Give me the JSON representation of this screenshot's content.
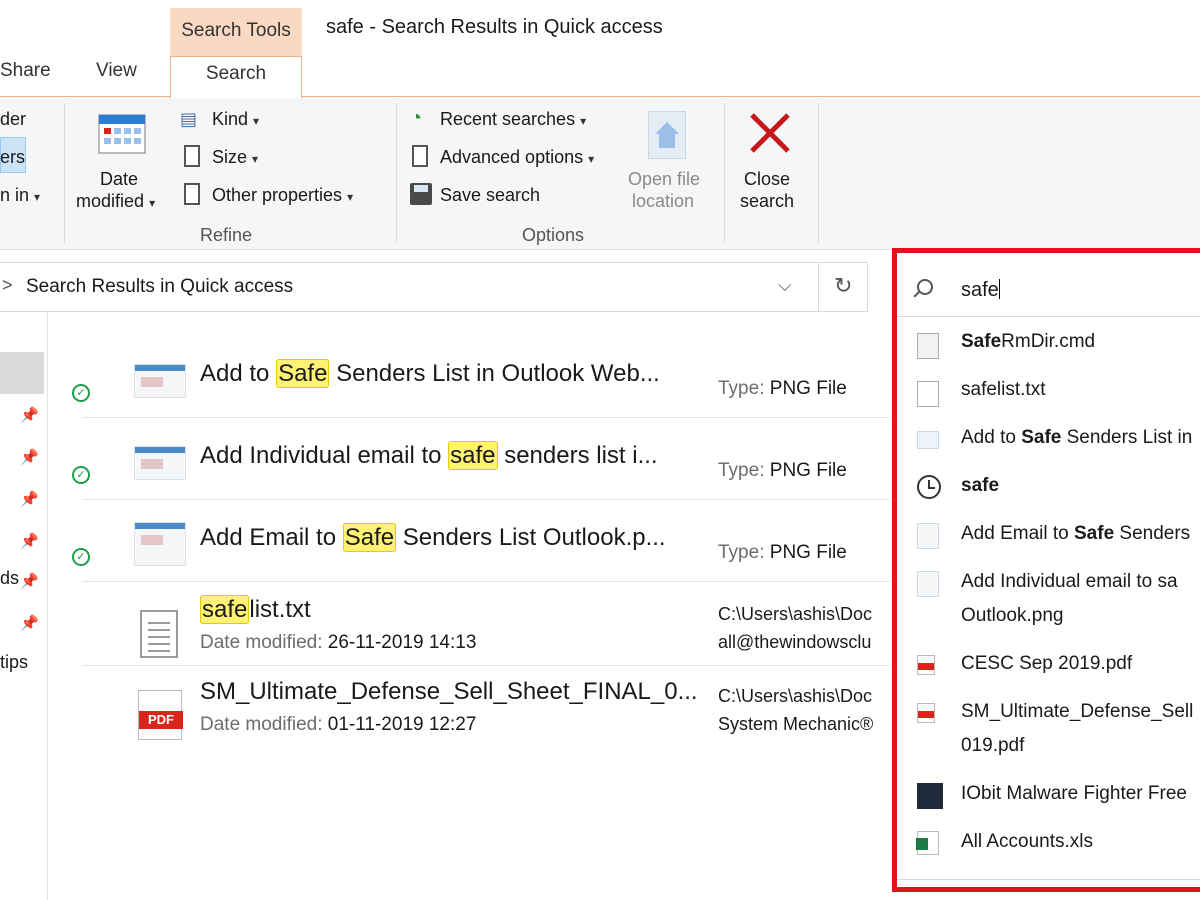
{
  "titlebar": {
    "context_group": "Search Tools",
    "window_title": "safe - Search Results in Quick access",
    "tabs": [
      "Share",
      "View",
      "Search"
    ]
  },
  "ribbon": {
    "partial_items": [
      "der",
      "ers",
      "n in"
    ],
    "date_modified": [
      "Date",
      "modified"
    ],
    "refine": {
      "kind": "Kind",
      "size": "Size",
      "other_properties": "Other properties",
      "label": "Refine"
    },
    "options": {
      "recent_searches": "Recent searches",
      "advanced_options": "Advanced options",
      "save_search": "Save search",
      "label": "Options"
    },
    "open_file_location": [
      "Open file",
      "location"
    ],
    "close_search": [
      "Close",
      "search"
    ]
  },
  "address": {
    "crumb": "Search Results in Quick access"
  },
  "nav": {
    "partial_items": [
      "ds",
      "tips"
    ]
  },
  "results": [
    {
      "pre": "Add to ",
      "hl": "Safe",
      "post": " Senders List in Outlook Web...",
      "meta_key": "Type:",
      "meta_val": "PNG File"
    },
    {
      "pre": "Add Individual email to ",
      "hl": "safe",
      "post": " senders list i...",
      "meta_key": "Type:",
      "meta_val": "PNG File"
    },
    {
      "pre": "Add Email to ",
      "hl": "Safe",
      "post": " Senders List Outlook.p...",
      "meta_key": "Type:",
      "meta_val": "PNG File"
    },
    {
      "pre": "",
      "hl": "safe",
      "post": "list.txt",
      "sub_key": "Date modified:",
      "sub_val": "26-11-2019 14:13",
      "path1": "C:\\Users\\ashis\\Doc",
      "path2": "all@thewindowsclu"
    },
    {
      "pre": "SM_Ultimate_Defense_Sell_Sheet_FINAL_0...",
      "hl": "",
      "post": "",
      "sub_key": "Date modified:",
      "sub_val": "01-11-2019 12:27",
      "path1": "C:\\Users\\ashis\\Doc",
      "path2": "System Mechanic®"
    }
  ],
  "search": {
    "value": "safe",
    "suggestions": [
      {
        "bold": "Safe",
        "rest": "RmDir.cmd",
        "icon": "cmd-file-icon"
      },
      {
        "bold": "",
        "rest": "safelist.txt",
        "icon": "text-file-icon"
      },
      {
        "pre": "Add to ",
        "bold": "Safe",
        "rest": " Senders List in",
        "icon": "image-file-icon"
      },
      {
        "bold": "safe",
        "rest": "",
        "icon": "history-icon"
      },
      {
        "pre": "Add Email to ",
        "bold": "Safe",
        "rest": " Senders",
        "icon": "image-file-icon"
      },
      {
        "pre": "Add Individual email to sa",
        "bold": "",
        "rest": "",
        "line2": "Outlook.png",
        "icon": "image-file-icon"
      },
      {
        "bold": "",
        "rest": "CESC Sep 2019.pdf",
        "icon": "pdf-file-icon"
      },
      {
        "bold": "",
        "rest": "SM_Ultimate_Defense_Sell",
        "line2": "019.pdf",
        "icon": "pdf-file-icon"
      },
      {
        "bold": "",
        "rest": "IObit Malware Fighter Free",
        "icon": "app-icon"
      },
      {
        "bold": "",
        "rest": "All Accounts.xls",
        "icon": "excel-file-icon"
      }
    ]
  },
  "colors": {
    "accent_orange": "#f9d9c2",
    "highlight": "#fff275",
    "red_frame": "#e0131f",
    "check_green": "#1f9f4a"
  }
}
